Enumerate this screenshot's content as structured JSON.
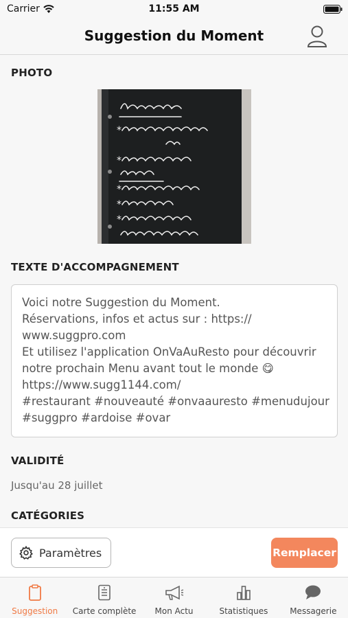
{
  "status": {
    "carrier": "Carrier",
    "time": "11:55 AM"
  },
  "nav": {
    "title": "Suggestion du Moment"
  },
  "photo": {
    "label": "PHOTO"
  },
  "text": {
    "label": "TEXTE D'ACCOMPAGNEMENT",
    "lines": [
      "Voici notre Suggestion du Moment.",
      "Réservations, infos et actus sur : https://",
      "www.suggpro.com",
      "Et utilisez l'application OnVaAuResto pour découvrir",
      "notre prochain Menu avant tout le monde 😋",
      "https://www.sugg1144.com/",
      "#restaurant #nouveauté #onvaauresto #menudujour",
      "#suggpro #ardoise #ovar"
    ]
  },
  "validity": {
    "label": "VALIDITÉ",
    "value": "Jusqu'au 28 juillet"
  },
  "categories": {
    "label": "CATÉGORIES"
  },
  "actions": {
    "params_label": "Paramètres",
    "replace_label": "Remplacer"
  },
  "tabs": [
    {
      "label": "Suggestion",
      "icon": "clipboard-icon",
      "active": true
    },
    {
      "label": "Carte complète",
      "icon": "menu-card-icon",
      "active": false
    },
    {
      "label": "Mon Actu",
      "icon": "megaphone-icon",
      "active": false
    },
    {
      "label": "Statistiques",
      "icon": "bar-chart-icon",
      "active": false
    },
    {
      "label": "Messagerie",
      "icon": "chat-bubble-icon",
      "active": false
    }
  ],
  "colors": {
    "accent": "#f07a45",
    "button": "#f3875d",
    "background": "#f7f7f7"
  }
}
